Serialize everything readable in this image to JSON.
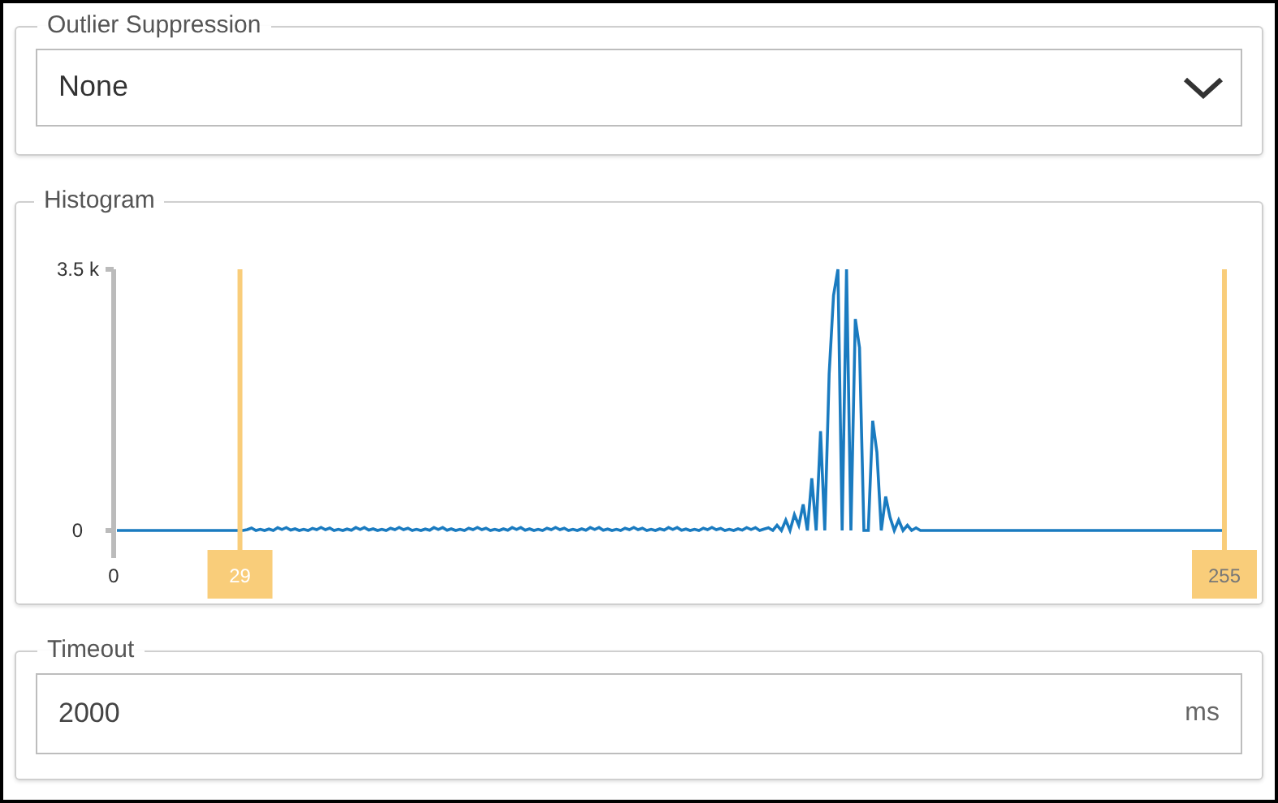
{
  "outlier_suppression": {
    "label": "Outlier Suppression",
    "value": "None"
  },
  "histogram": {
    "label": "Histogram",
    "y_max_label": "3.5 k",
    "y_min_label": "0",
    "x_min_label": "0",
    "range_low": {
      "value": "29",
      "level": 0.1137
    },
    "range_high": {
      "value": "255",
      "level": 1
    }
  },
  "timeout": {
    "label": "Timeout",
    "value": "2000",
    "unit": "ms"
  }
}
